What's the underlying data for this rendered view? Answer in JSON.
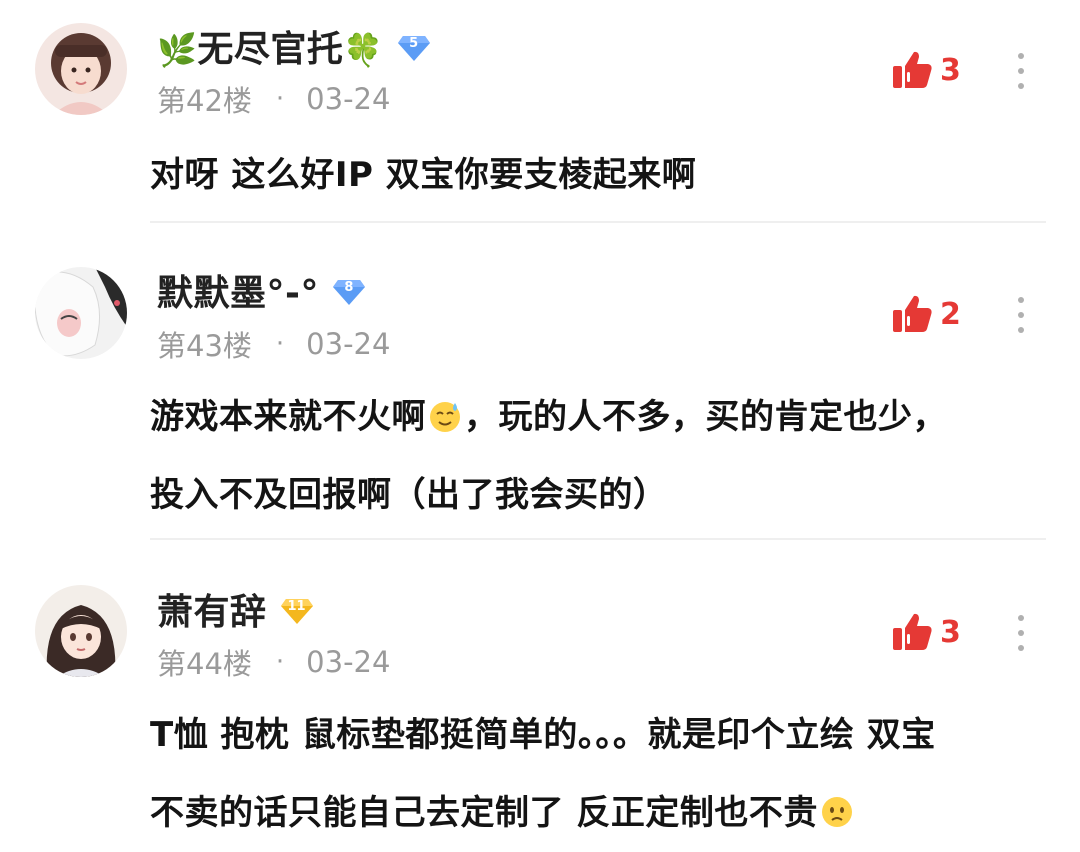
{
  "comments": [
    {
      "username": "无尽官托",
      "name_prefix_icon": "leaf-icon",
      "name_suffix_icon": "clover-icon",
      "level": "5",
      "level_color": "#5b9cf5",
      "floor": "第42楼",
      "separator": "·",
      "date": "03-24",
      "like_count": "3",
      "text_lines": [
        "对呀 这么好IP 双宝你要支棱起来啊"
      ]
    },
    {
      "username": "默默墨°-°",
      "level": "8",
      "level_color": "#5b9cf5",
      "floor": "第43楼",
      "separator": "·",
      "date": "03-24",
      "like_count": "2",
      "text_lines": [
        "游戏本来就不火啊",
        "，玩的人不多，买的肯定也少，",
        "投入不及回报啊（出了我会买的）"
      ],
      "emoji": "sweat-smile-emoji"
    },
    {
      "username": "萧有辞",
      "level": "11",
      "level_color": "#f4b71e",
      "floor": "第44楼",
      "separator": "·",
      "date": "03-24",
      "like_count": "3",
      "text_lines": [
        "T恤 抱枕 鼠标垫都挺简单的。。。就是印个立绘 双宝",
        "不卖的话只能自己去定制了 反正定制也不贵"
      ],
      "emoji": "worried-face-emoji"
    }
  ],
  "like_color": "#e53935"
}
